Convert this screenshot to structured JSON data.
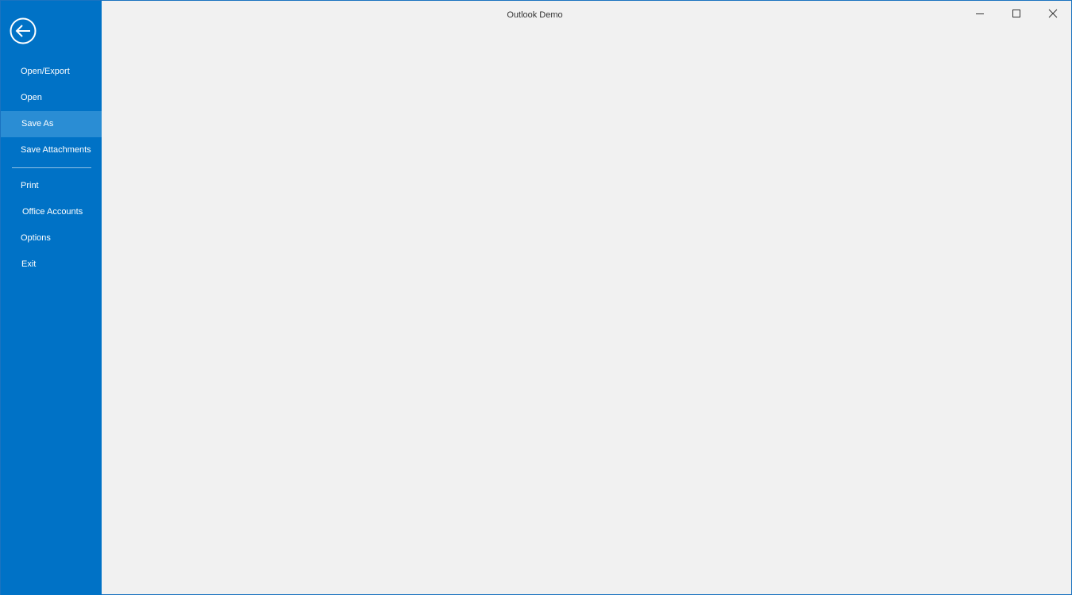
{
  "window": {
    "title": "Outlook Demo"
  },
  "backstage": {
    "back_icon": "arrow-left-circle-icon",
    "items": [
      {
        "label": "Open/Export"
      },
      {
        "label": "Open"
      },
      {
        "label": "Save As",
        "selected": true
      },
      {
        "label": "Save Attachments"
      },
      {
        "label": "Print"
      },
      {
        "label": "Office Accounts"
      },
      {
        "label": "Options"
      },
      {
        "label": "Exit"
      }
    ]
  },
  "window_controls": {
    "minimize_icon": "minimize-icon",
    "maximize_icon": "maximize-icon",
    "close_icon": "close-icon"
  },
  "colors": {
    "accent": "#0072c6",
    "selected": "#2a8dd4",
    "background": "#f1f1f1"
  }
}
